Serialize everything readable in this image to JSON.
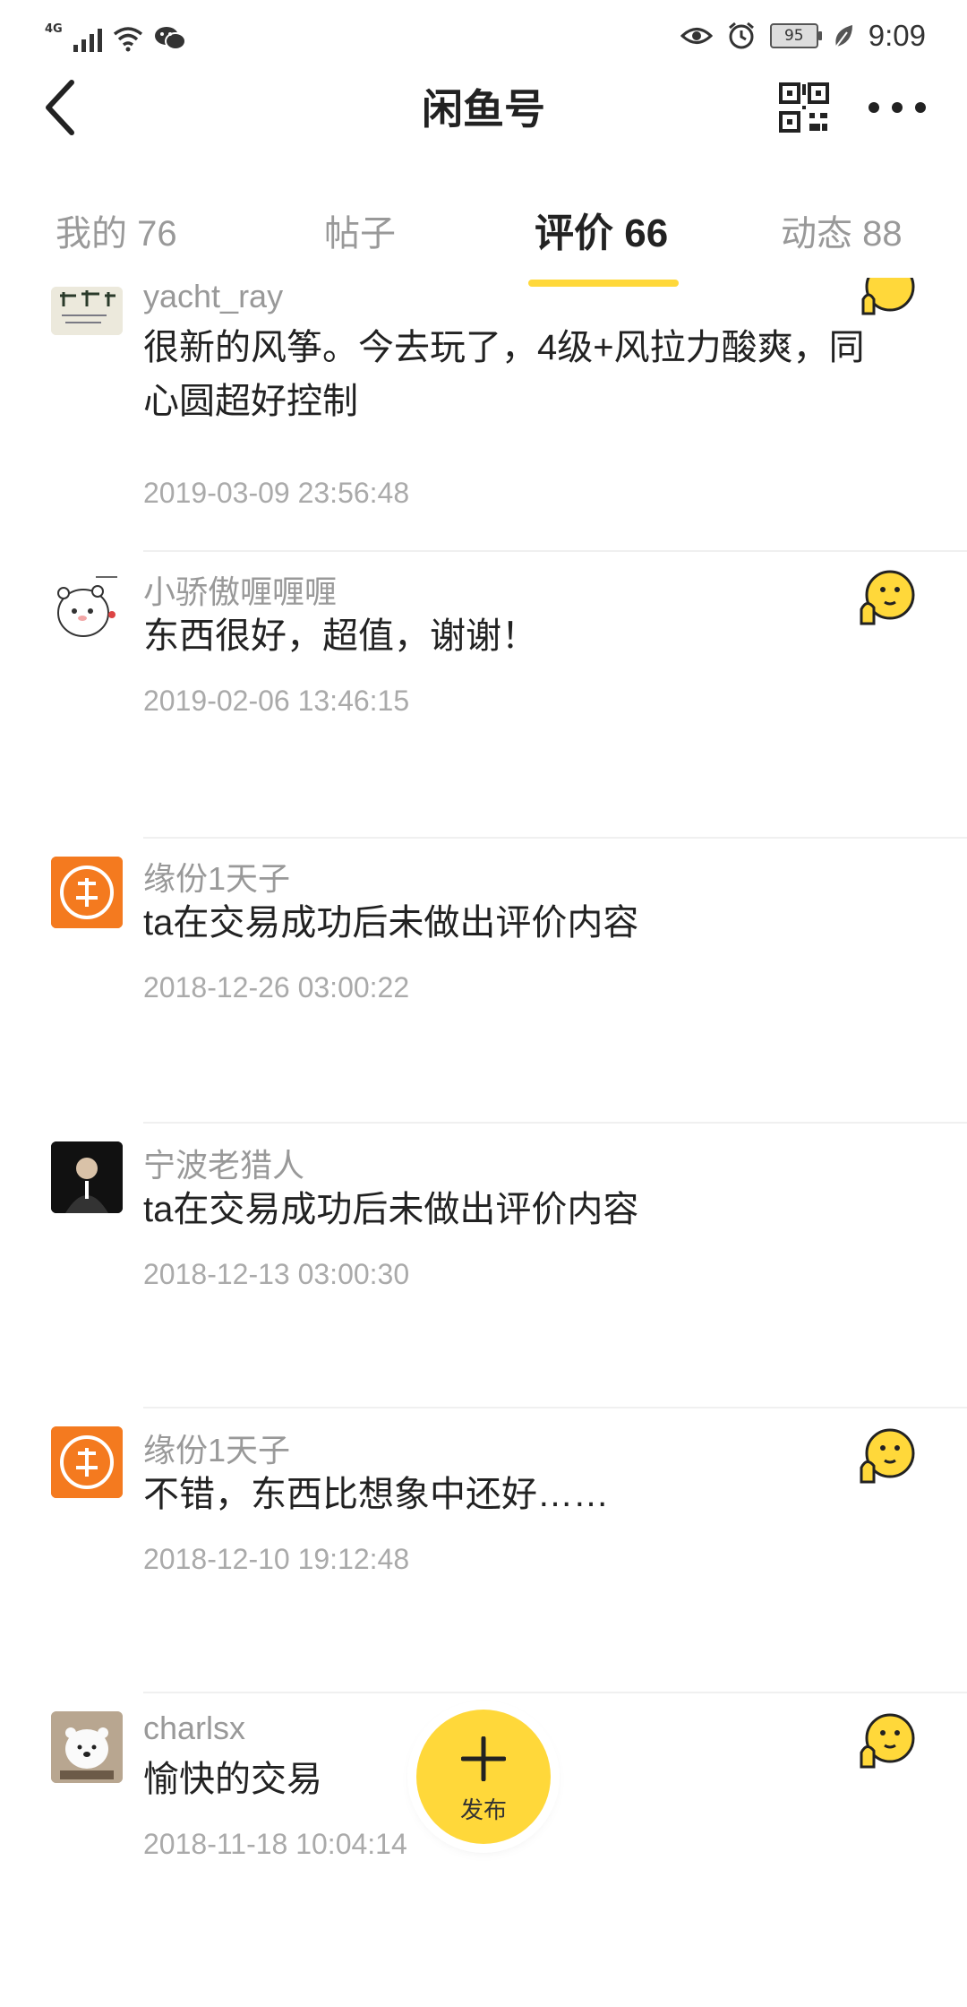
{
  "status_bar": {
    "network": "4G",
    "battery": "95",
    "time": "9:09"
  },
  "header": {
    "title": "闲鱼号"
  },
  "tabs": [
    {
      "label": "我的 76"
    },
    {
      "label": "帖子"
    },
    {
      "label": "评价 66"
    },
    {
      "label": "动态 88"
    }
  ],
  "reviews": [
    {
      "user": "yacht_ray",
      "content": "很新的风筝。今去玩了，4级+风拉力酸爽，同心圆超好控制",
      "date": "2019-03-09 23:56:48",
      "emoji": "thumbs-up-face-icon"
    },
    {
      "user": "小骄傲喱喱喱",
      "content": "东西很好，超值，谢谢！",
      "date": "2019-02-06 13:46:15",
      "emoji": "thumbs-up-face-icon"
    },
    {
      "user": "缘份1天子",
      "content": "ta在交易成功后未做出评价内容",
      "date": "2018-12-26 03:00:22"
    },
    {
      "user": "宁波老猎人",
      "content": "ta在交易成功后未做出评价内容",
      "date": "2018-12-13 03:00:30"
    },
    {
      "user": "缘份1天子",
      "content": "不错，东西比想象中还好……",
      "date": "2018-12-10 19:12:48",
      "emoji": "thumbs-up-face-icon"
    },
    {
      "user": "charlsx",
      "content": "愉快的交易",
      "date": "2018-11-18 10:04:14",
      "emoji": "thumbs-up-face-icon"
    }
  ],
  "fab": {
    "label": "发布"
  },
  "colors": {
    "accent": "#ffd83a",
    "text": "#222222",
    "muted": "#999999"
  }
}
